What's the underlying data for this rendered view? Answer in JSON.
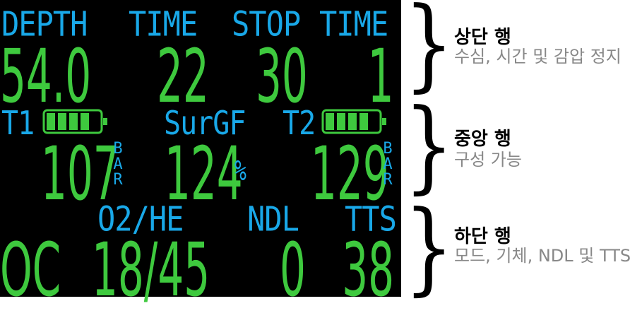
{
  "top": {
    "label_depth": "DEPTH",
    "label_time": "TIME",
    "label_stop": "STOP",
    "label_stop_time": "TIME",
    "depth": "54.0",
    "time": "22",
    "stop_depth": "30",
    "stop_time": "1"
  },
  "middle": {
    "t1_label": "T1",
    "t2_label": "T2",
    "t1_battery_level": 0.8,
    "t2_battery_level": 0.8,
    "surgf_label": "SurGF",
    "t1_pressure": "107",
    "surgf_value": "124",
    "surgf_unit": "%",
    "t2_pressure": "129",
    "pressure_unit_letters": [
      "B",
      "A",
      "R"
    ]
  },
  "bottom": {
    "label_o2he": "O2/HE",
    "label_ndl": "NDL",
    "label_tts": "TTS",
    "mode": "OC",
    "gas": "18/45",
    "ndl": "0",
    "tts": "38"
  },
  "annotations": [
    {
      "title": "상단 행",
      "desc": "수심, 시간 및 감압 정지"
    },
    {
      "title": "중앙 행",
      "desc": "구성 가능"
    },
    {
      "title": "하단 행",
      "desc": "모드, 기체, NDL 및 TTS"
    }
  ],
  "colors": {
    "screen_background": "#000000",
    "label": "#19a8e8",
    "value": "#3ec93e",
    "annotation_desc": "#888888"
  }
}
